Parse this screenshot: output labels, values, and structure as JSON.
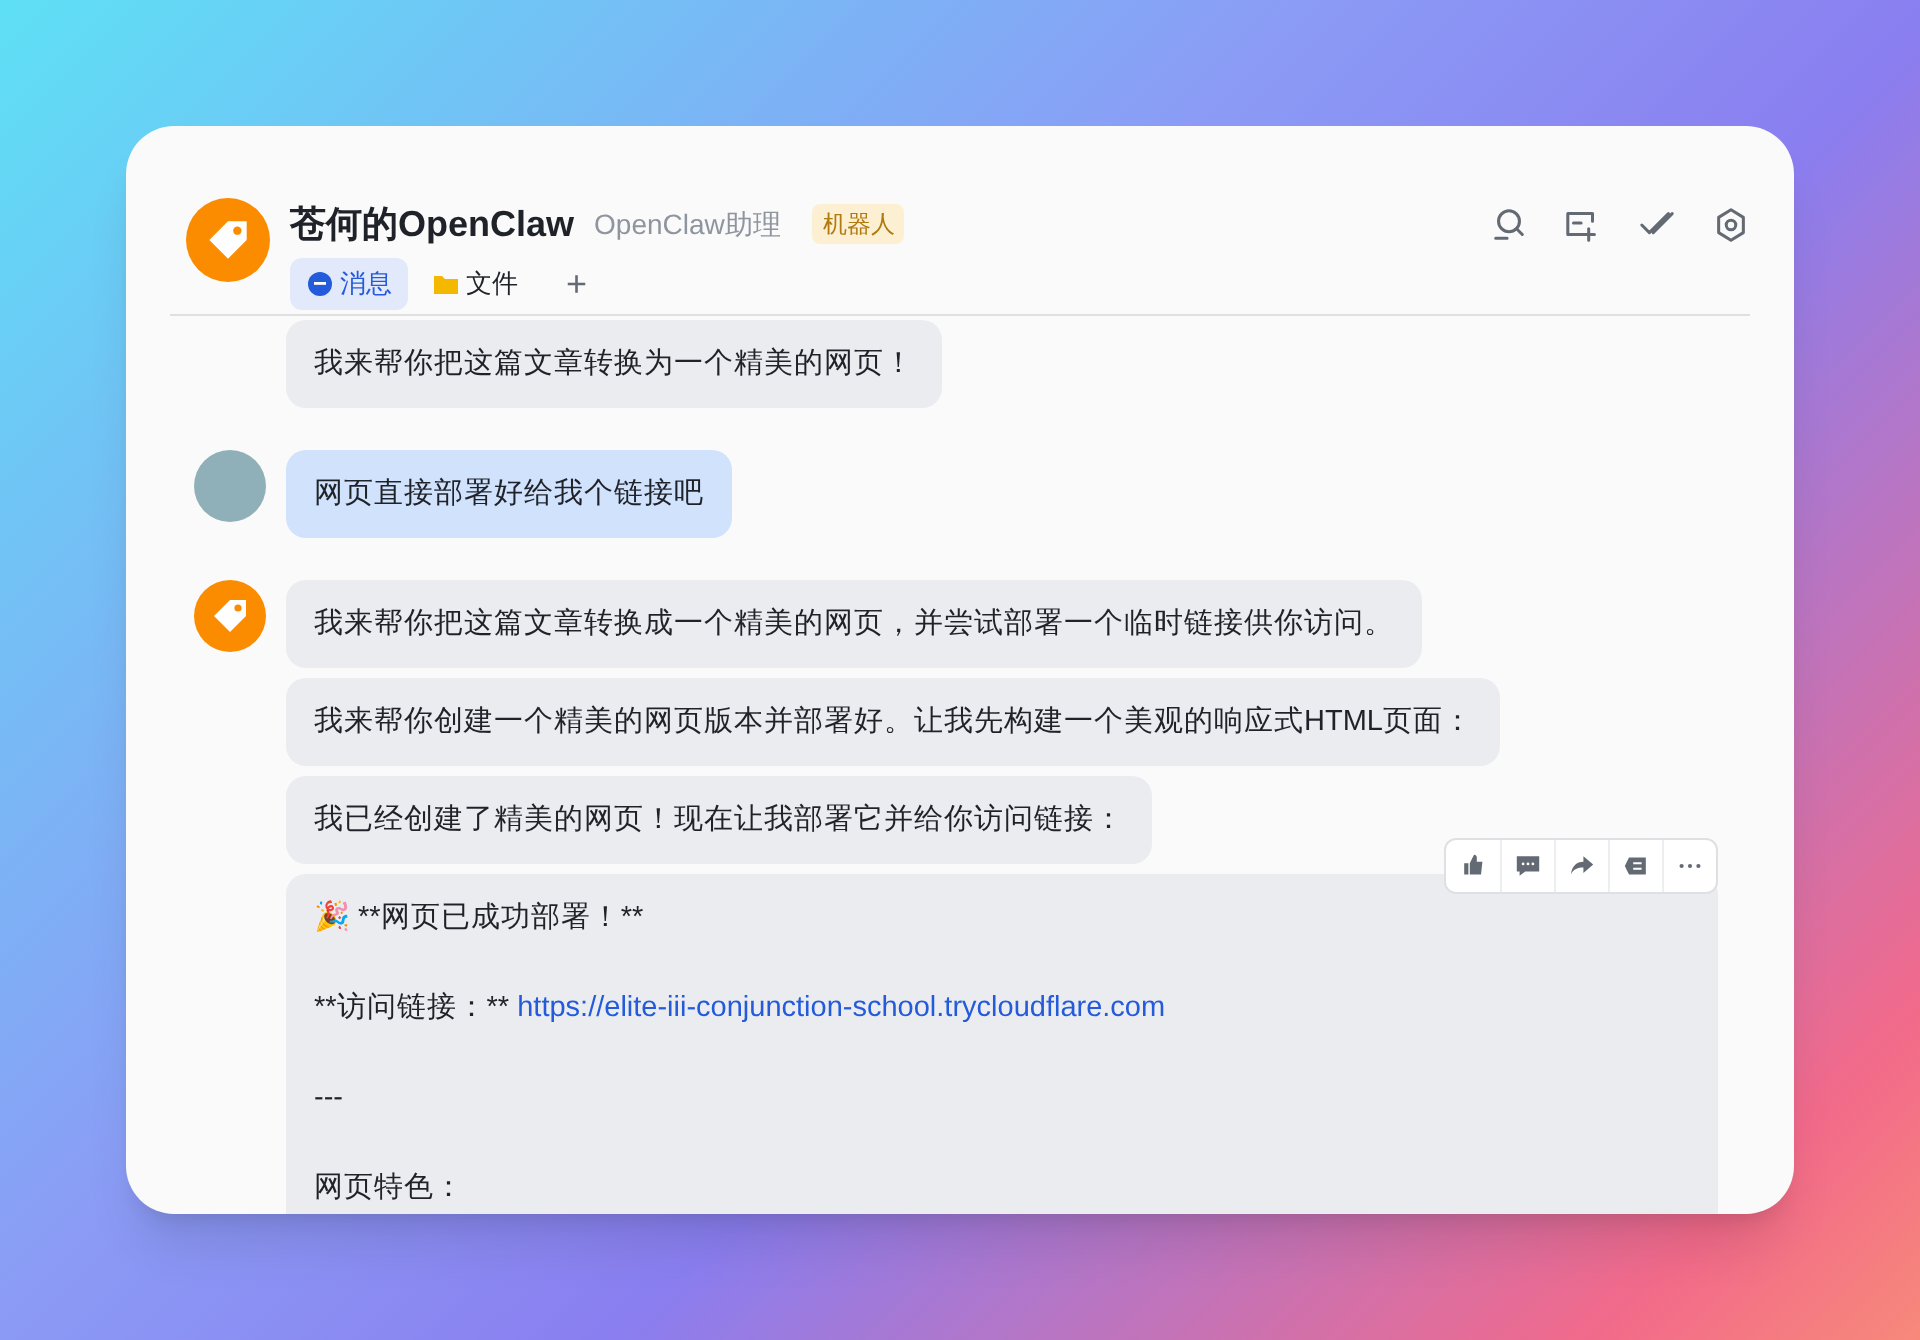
{
  "header": {
    "title": "苍何的OpenClaw",
    "subtitle": "OpenClaw助理",
    "badge": "机器人",
    "tabs": [
      {
        "label": "消息",
        "kind": "chat",
        "selected": true
      },
      {
        "label": "文件",
        "kind": "folder",
        "selected": false
      }
    ],
    "add_tab": "+"
  },
  "messages": [
    {
      "kind": "bot",
      "show_avatar": false,
      "bubbles": [
        {
          "kind": "text",
          "text": "我来帮你把这篇文章转换为一个精美的网页！"
        }
      ]
    },
    {
      "kind": "user",
      "show_avatar": true,
      "bubbles": [
        {
          "kind": "text",
          "text": "网页直接部署好给我个链接吧"
        }
      ]
    },
    {
      "kind": "bot",
      "show_avatar": true,
      "bubbles": [
        {
          "kind": "text",
          "text": "我来帮你把这篇文章转换成一个精美的网页，并尝试部署一个临时链接供你访问。"
        },
        {
          "kind": "text",
          "text": "我来帮你创建一个精美的网页版本并部署好。让我先构建一个美观的响应式HTML页面："
        },
        {
          "kind": "text",
          "text": "我已经创建了精美的网页！现在让我部署它并给你访问链接："
        },
        {
          "kind": "rich",
          "actions_visible": true,
          "lines": [
            {
              "kind": "text",
              "text": "🎉 **网页已成功部署！**"
            },
            {
              "kind": "link",
              "label": "**访问链接：** ",
              "url": "https://elite-iii-conjunction-school.trycloudflare.com"
            },
            {
              "kind": "text",
              "text": "---"
            },
            {
              "kind": "text",
              "text": "网页特色："
            }
          ]
        }
      ]
    }
  ]
}
